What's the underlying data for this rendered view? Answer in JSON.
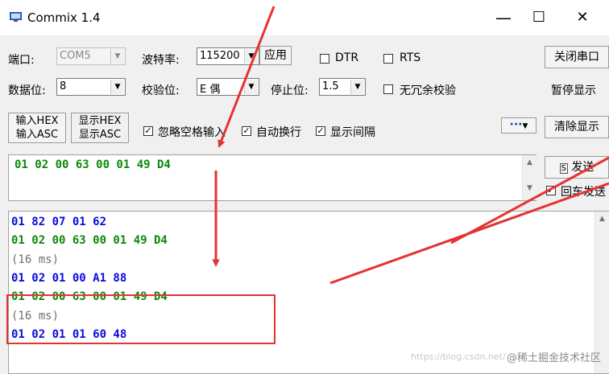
{
  "window": {
    "title": "Commix 1.4",
    "minimize": "—",
    "maximize": "☐",
    "close": "✕"
  },
  "row1": {
    "port_label": "端口:",
    "port_value": "COM5",
    "baud_label": "波特率:",
    "baud_value": "115200",
    "apply_button": "应用",
    "dtr_label": "DTR",
    "rts_label": "RTS",
    "close_port_button": "关闭串口"
  },
  "row2": {
    "databits_label": "数据位:",
    "databits_value": "8",
    "parity_label": "校验位:",
    "parity_value": "E 偶",
    "stopbits_label": "停止位:",
    "stopbits_value": "1.5",
    "no_redundant_label": "无冗余校验",
    "pause_button": "暂停显示"
  },
  "row3": {
    "input_hex": "输入HEX",
    "input_asc": "输入ASC",
    "display_hex": "显示HEX",
    "display_asc": "显示ASC",
    "ignore_space_label": "忽略空格输入",
    "auto_wrap_label": "自动换行",
    "show_interval_label": "显示间隔",
    "more_button": "···",
    "clear_button": "清除显示"
  },
  "send": {
    "text": "01 02 00 63 00 01 49 D4",
    "send_button": "发送",
    "cr_send_label": "回车发送"
  },
  "receive": {
    "lines": [
      {
        "text": "01 82 07 01 62",
        "color": "#0a0ae0",
        "kind": "rx"
      },
      {
        "text": "01 02 00 63 00 01 49 D4",
        "color": "#0a8a0a",
        "kind": "tx"
      },
      {
        "text": "(16 ms)",
        "color": "#707070",
        "kind": "interval"
      },
      {
        "text": "01 02 01 00 A1 88",
        "color": "#0a0ae0",
        "kind": "rx"
      },
      {
        "text": "01 02 00 63 00 01 49 D4",
        "color": "#0a8a0a",
        "kind": "tx"
      },
      {
        "text": "(16 ms)",
        "color": "#707070",
        "kind": "interval"
      },
      {
        "text": "01 02 01 01 60 48",
        "color": "#0a0ae0",
        "kind": "rx"
      }
    ]
  },
  "watermark": {
    "main": "@稀土掘金技术社区",
    "faint": "https://blog.csdn.net/"
  },
  "colors": {
    "annotation": "#e53333",
    "tx": "#0a8a0a",
    "rx": "#0a0ae0",
    "interval": "#707070"
  }
}
